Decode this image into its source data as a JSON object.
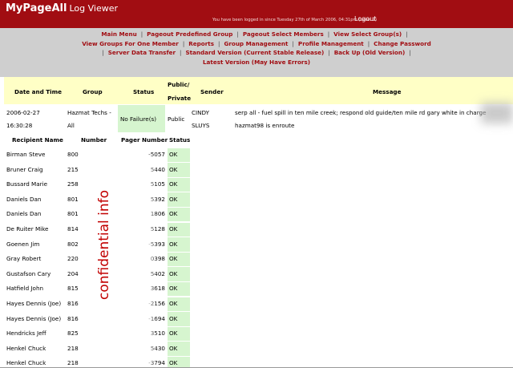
{
  "header": {
    "brand": "MyPageAll",
    "subtitle": "Log Viewer",
    "login_message": "You have been logged in since Tuesday 27th of March 2006, 04:31pm (Level 2)",
    "logout": "Logout"
  },
  "nav": {
    "line1": [
      "Main Menu",
      "Pageout Predefined Group",
      "Pageout Select Members",
      "View Select Group(s)"
    ],
    "line2": [
      "View Groups For One Member",
      "Reports",
      "Group Management",
      "Profile Management",
      "Change Password"
    ],
    "line3": [
      "Server Data Transfer",
      "Standard Version (Current Stable Release)",
      "Back Up (Old Version)"
    ],
    "line4": "Latest Version (May Have Errors)"
  },
  "message_table": {
    "headers": {
      "date_time": "Date and Time",
      "group": "Group",
      "status": "Status",
      "public_private_1": "Public/",
      "public_private_2": "Private",
      "sender": "Sender",
      "message": "Message"
    },
    "row": {
      "date": "2006-02-27",
      "time": "16:30:28",
      "group_1": "Hazmat Techs -",
      "group_2": "All",
      "status": "No Failure(s)",
      "visibility": "Public",
      "sender_1": "CINDY",
      "sender_2": "SLUYS",
      "message_1": "serp all - fuel spill in ten mile creek; respond old guide/ten mile rd gary white in charge",
      "message_2": "hazmat98 is enroute"
    }
  },
  "recipients": {
    "headers": {
      "name": "Recipient Name",
      "number": "Number",
      "pager": "Pager Number",
      "status": "Status"
    },
    "rows": [
      {
        "name": "Birman Steve",
        "number": "800",
        "pager": "-5057",
        "status": "OK"
      },
      {
        "name": "Bruner Craig",
        "number": "215",
        "pager": "5440",
        "status": "OK"
      },
      {
        "name": "Bussard Marie",
        "number": "258",
        "pager": "5105",
        "status": "OK"
      },
      {
        "name": "Daniels Dan",
        "number": "801",
        "pager": "5392",
        "status": "OK"
      },
      {
        "name": "Daniels Dan",
        "number": "801",
        "pager": "1806",
        "status": "OK"
      },
      {
        "name": "De Ruiter Mike",
        "number": "814",
        "pager": "5128",
        "status": "OK"
      },
      {
        "name": "Goenen Jim",
        "number": "802",
        "pager": "-5393",
        "status": "OK"
      },
      {
        "name": "Gray Robert",
        "number": "220",
        "pager": "0398",
        "status": "OK"
      },
      {
        "name": "Gustafson Cary",
        "number": "204",
        "pager": "5402",
        "status": "OK"
      },
      {
        "name": "Hatfield John",
        "number": "815",
        "pager": "3618",
        "status": "OK"
      },
      {
        "name": "Hayes Dennis (Joe)",
        "number": "816",
        "pager": "-2156",
        "status": "OK"
      },
      {
        "name": "Hayes Dennis (Joe)",
        "number": "816",
        "pager": "-1694",
        "status": "OK"
      },
      {
        "name": "Hendricks Jeff",
        "number": "825",
        "pager": "3510",
        "status": "OK"
      },
      {
        "name": "Henkel Chuck",
        "number": "218",
        "pager": "5430",
        "status": "OK"
      },
      {
        "name": "Henkel Chuck",
        "number": "218",
        "pager": "-3794",
        "status": "OK"
      }
    ]
  },
  "watermark": "confidential info",
  "colors": {
    "header_red": "#a10d12",
    "nav_gray": "#cfcfcf",
    "header_yellow": "#ffffc6",
    "status_green": "#d6f5cf"
  }
}
